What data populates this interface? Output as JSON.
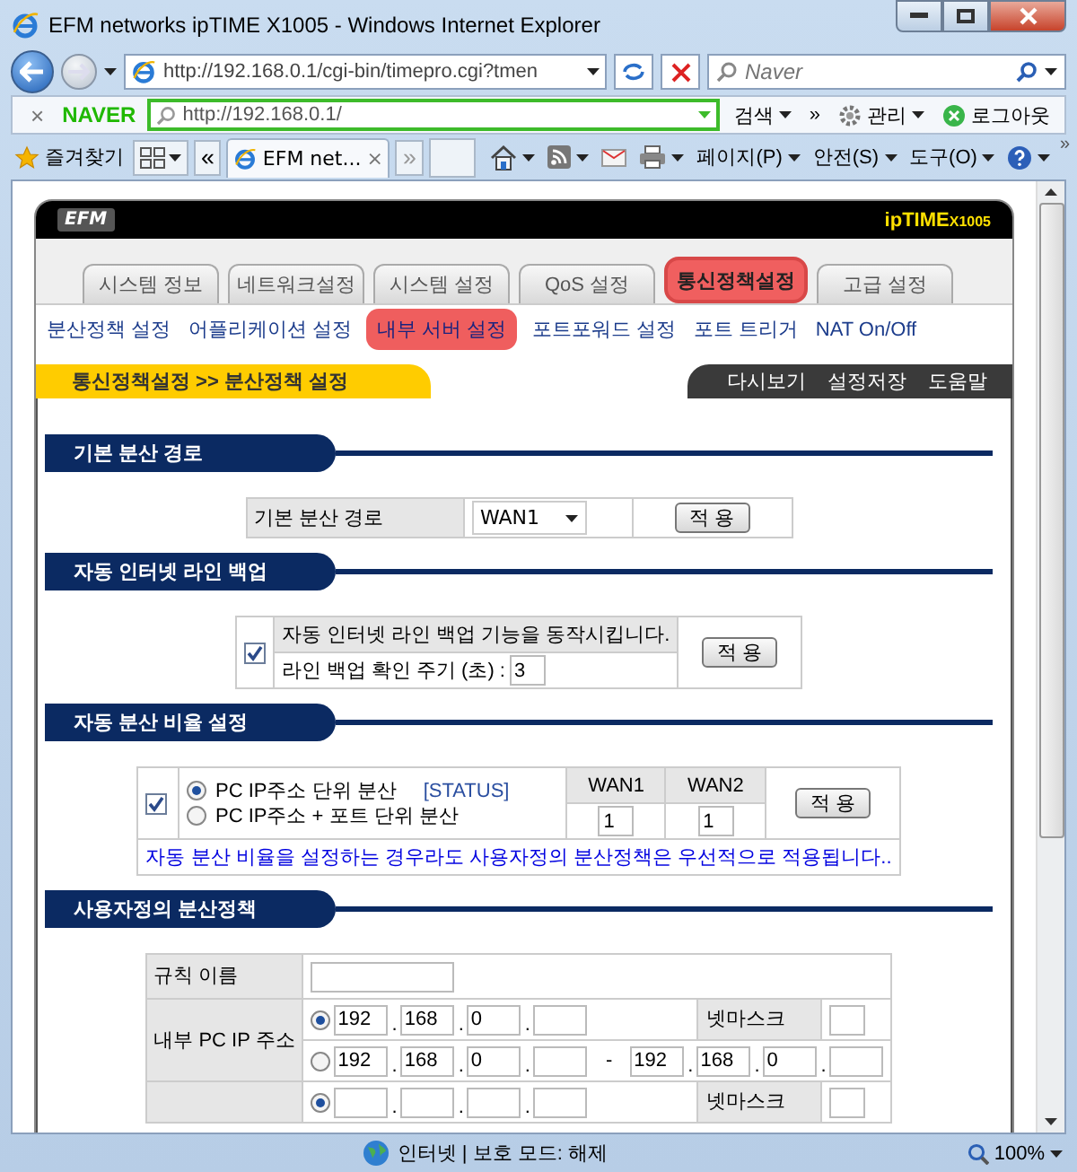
{
  "window": {
    "title": "EFM networks ipTIME X1005 - Windows Internet Explorer"
  },
  "address_bar": {
    "url": "http://192.168.0.1/cgi-bin/timepro.cgi?tmen"
  },
  "search_box": {
    "placeholder": "Naver"
  },
  "naver_toolbar": {
    "close": "×",
    "logo": "NAVER",
    "url": "http://192.168.0.1/",
    "search": "검색",
    "more": "»",
    "manage": "관리",
    "logout": "로그아웃"
  },
  "command_bar": {
    "favorites": "즐겨찾기",
    "back": "«",
    "tab": "EFM net...",
    "tab_close": "×",
    "more": "»",
    "menus": [
      "페이지(P)",
      "안전(S)",
      "도구(O)"
    ],
    "overflow": "»"
  },
  "router": {
    "logo": "EFM",
    "brand": "ipTIME",
    "model": "X1005",
    "tabs": [
      {
        "label": "시스템 정보",
        "selected": false
      },
      {
        "label": "네트워크설정",
        "selected": false
      },
      {
        "label": "시스템 설정",
        "selected": false
      },
      {
        "label": "QoS 설정",
        "selected": false
      },
      {
        "label": "통신정책설정",
        "selected": true
      },
      {
        "label": "고급 설정",
        "selected": false
      }
    ],
    "submenu": [
      {
        "label": "분산정책 설정",
        "selected": false
      },
      {
        "label": "어플리케이션 설정",
        "selected": false
      },
      {
        "label": "내부 서버 설정",
        "selected": true
      },
      {
        "label": "포트포워드 설정",
        "selected": false
      },
      {
        "label": "포트 트리거",
        "selected": false
      },
      {
        "label": "NAT On/Off",
        "selected": false
      }
    ],
    "breadcrumb": "통신정책설정 >> 분산정책 설정",
    "actions": [
      "다시보기",
      "설정저장",
      "도움말"
    ],
    "sections": [
      {
        "kind": "route",
        "title": "기본 분산 경로",
        "label": "기본 분산 경로",
        "value": "WAN1",
        "button": "적 용"
      },
      {
        "kind": "backup",
        "title": "자동 인터넷 라인 백업",
        "checked": true,
        "label": "자동 인터넷 라인 백업 기능을 동작시킵니다.",
        "period_label": "라인 백업 확인 주기 (초) :",
        "period": "3",
        "button": "적 용"
      },
      {
        "kind": "ratio",
        "title": "자동 분산 비율 설정",
        "checked": true,
        "options": [
          {
            "label": "PC IP주소 단위 분산",
            "selected": true,
            "status": "[STATUS]"
          },
          {
            "label": "PC IP주소 + 포트 단위 분산",
            "selected": false
          }
        ],
        "wans": [
          {
            "name": "WAN1",
            "value": "1"
          },
          {
            "name": "WAN2",
            "value": "1"
          }
        ],
        "button": "적 용",
        "note": "자동 분산 비율을 설정하는 경우라도 사용자정의 분산정책은 우선적으로 적용됩니다.."
      },
      {
        "kind": "custom",
        "title": "사용자정의 분산정책",
        "rule_label": "규칙 이름",
        "separator": ".",
        "range_separator": "-",
        "groups": [
          {
            "label": "내부 PC IP 주소",
            "rows": [
              {
                "kind": "single",
                "selected": true,
                "ip": [
                  "192",
                  "168",
                  "0"
                ],
                "netmask_label": "넷마스크"
              },
              {
                "kind": "range",
                "selected": false,
                "ip": [
                  "192",
                  "168",
                  "0"
                ],
                "ip_end": [
                  "192",
                  "168",
                  "0"
                ]
              }
            ]
          },
          {
            "rows": [
              {
                "kind": "single",
                "selected": true,
                "netmask_label": "넷마스크"
              }
            ]
          }
        ]
      }
    ]
  },
  "status_bar": {
    "zone": "인터넷 | 보호 모드: 해제",
    "zoom": "100%"
  }
}
